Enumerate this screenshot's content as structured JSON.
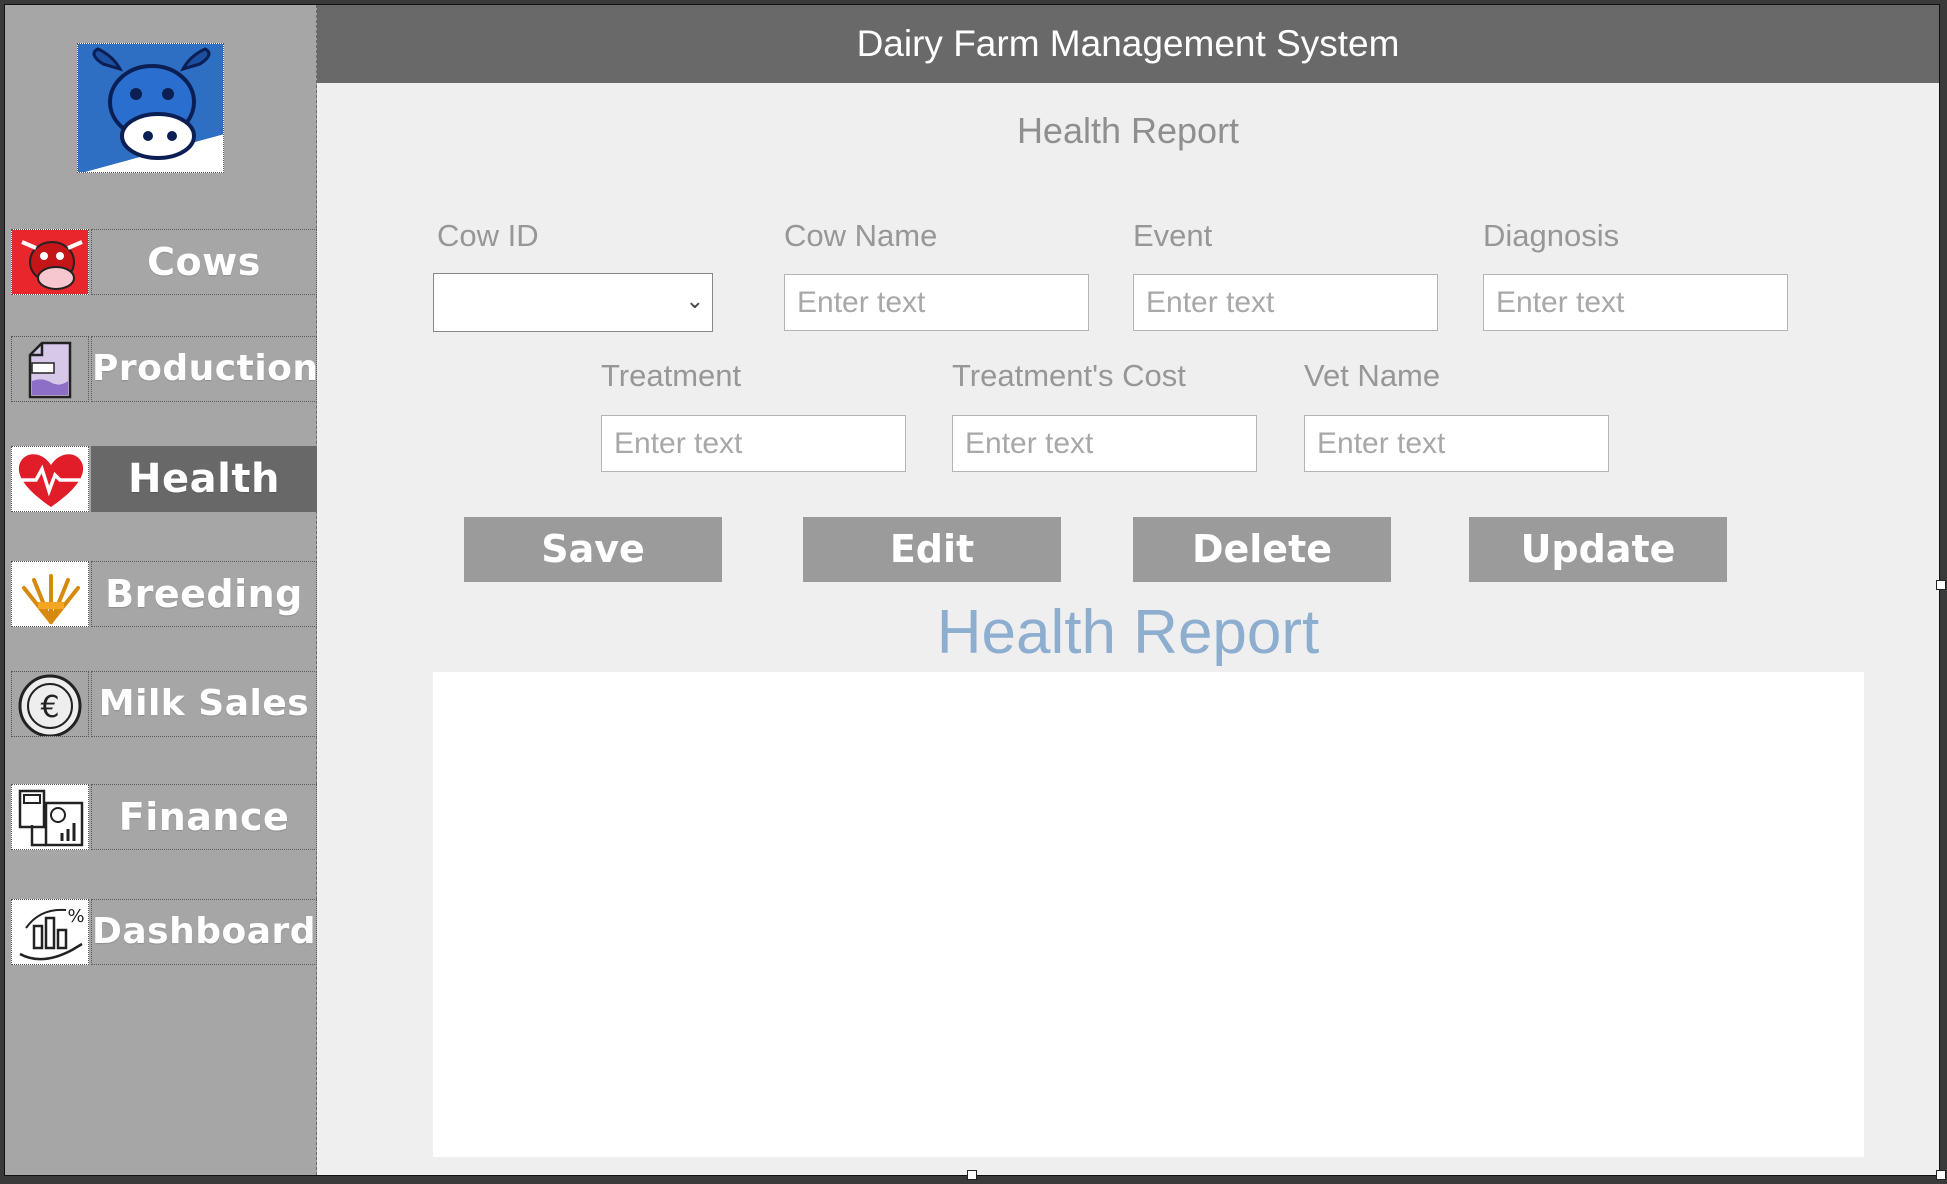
{
  "app": {
    "title": "Dairy Farm Management System"
  },
  "sidebar": {
    "items": [
      {
        "label": "Cows",
        "icon": "cow-icon"
      },
      {
        "label": "Production",
        "icon": "milk-carton-icon"
      },
      {
        "label": "Health",
        "icon": "heartbeat-icon",
        "active": true
      },
      {
        "label": "Breeding",
        "icon": "wheat-icon"
      },
      {
        "label": "Milk Sales",
        "icon": "euro-coin-icon"
      },
      {
        "label": "Finance",
        "icon": "calculator-chart-icon"
      },
      {
        "label": "Dashboard",
        "icon": "analytics-icon"
      }
    ]
  },
  "form": {
    "title": "Health Report",
    "fields": {
      "cow_id": {
        "label": "Cow ID",
        "value": ""
      },
      "cow_name": {
        "label": "Cow Name",
        "placeholder": "Enter text"
      },
      "event": {
        "label": "Event",
        "placeholder": "Enter text"
      },
      "diagnosis": {
        "label": "Diagnosis",
        "placeholder": "Enter text"
      },
      "treatment": {
        "label": "Treatment",
        "placeholder": "Enter text"
      },
      "treatment_cost": {
        "label": "Treatment's Cost",
        "placeholder": "Enter text"
      },
      "vet_name": {
        "label": "Vet Name",
        "placeholder": "Enter text"
      }
    },
    "buttons": {
      "save": "Save",
      "edit": "Edit",
      "delete": "Delete",
      "update": "Update"
    }
  },
  "table": {
    "title": "Health Report",
    "rows": []
  },
  "colors": {
    "sidebar": "#a6a6a6",
    "active_item": "#686868",
    "header": "#696969",
    "button": "#9b9b9b",
    "table_title": "#8eaed0"
  }
}
